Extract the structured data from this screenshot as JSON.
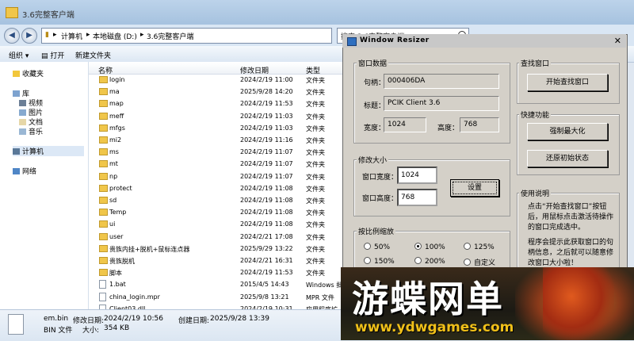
{
  "explorer": {
    "window_title": "3.6完整客户端",
    "address": {
      "segments": [
        "计算机",
        "本地磁盘 (D:)",
        "3.6完整客户端"
      ]
    },
    "search_placeholder": "搜索 3.6完整客户端",
    "toolbar": {
      "organize": "组织",
      "open": "打开",
      "new_folder": "新建文件夹"
    },
    "nav": {
      "favorites": "收藏夹",
      "library": "库",
      "videos": "视频",
      "pictures": "图片",
      "documents": "文档",
      "music": "音乐",
      "computer": "计算机",
      "network": "网络"
    },
    "columns": {
      "name": "名称",
      "date": "修改日期",
      "type": "类型"
    },
    "rows": [
      {
        "name": "login",
        "date": "2024/2/19 11:00",
        "type": "文件夹",
        "kind": "folder"
      },
      {
        "name": "ma",
        "date": "2025/9/28 14:20",
        "type": "文件夹",
        "kind": "folder"
      },
      {
        "name": "map",
        "date": "2024/2/19 11:53",
        "type": "文件夹",
        "kind": "folder"
      },
      {
        "name": "meff",
        "date": "2024/2/19 11:03",
        "type": "文件夹",
        "kind": "folder"
      },
      {
        "name": "mfgs",
        "date": "2024/2/19 11:03",
        "type": "文件夹",
        "kind": "folder"
      },
      {
        "name": "mi2",
        "date": "2024/2/19 11:16",
        "type": "文件夹",
        "kind": "folder"
      },
      {
        "name": "ms",
        "date": "2024/2/19 11:07",
        "type": "文件夹",
        "kind": "folder"
      },
      {
        "name": "mt",
        "date": "2024/2/19 11:07",
        "type": "文件夹",
        "kind": "folder"
      },
      {
        "name": "np",
        "date": "2024/2/19 11:07",
        "type": "文件夹",
        "kind": "folder"
      },
      {
        "name": "protect",
        "date": "2024/2/19 11:08",
        "type": "文件夹",
        "kind": "folder"
      },
      {
        "name": "sd",
        "date": "2024/2/19 11:08",
        "type": "文件夹",
        "kind": "folder"
      },
      {
        "name": "Temp",
        "date": "2024/2/19 11:08",
        "type": "文件夹",
        "kind": "folder"
      },
      {
        "name": "ui",
        "date": "2024/2/19 11:08",
        "type": "文件夹",
        "kind": "folder"
      },
      {
        "name": "user",
        "date": "2024/2/21 17:08",
        "type": "文件夹",
        "kind": "folder"
      },
      {
        "name": "贵族内挂+脱机+鼠标连点器",
        "date": "2025/9/29 13:22",
        "type": "文件夹",
        "kind": "folder"
      },
      {
        "name": "贵族脱机",
        "date": "2024/2/21 16:31",
        "type": "文件夹",
        "kind": "folder"
      },
      {
        "name": "脚本",
        "date": "2024/2/19 11:53",
        "type": "文件夹",
        "kind": "folder"
      },
      {
        "name": "1.bat",
        "date": "2015/4/5 14:43",
        "type": "Windows 批",
        "kind": "file"
      },
      {
        "name": "china_login.mpr",
        "date": "2025/9/8 13:21",
        "type": "MPR 文件",
        "kind": "file"
      },
      {
        "name": "Client03.dll",
        "date": "2024/2/19 10:31",
        "type": "应用程序扩",
        "kind": "file"
      }
    ],
    "details": {
      "filename": "em.bin",
      "modified_label": "修改日期:",
      "modified": "2024/2/19 10:56",
      "created_label": "创建日期:",
      "created": "2025/9/28 13:39",
      "filetype": "BIN 文件",
      "size_label": "大小:",
      "size": "354 KB"
    }
  },
  "resizer": {
    "title": "Window Resizer",
    "window_data": {
      "group_label": "窗口数据",
      "handle_label": "句柄：",
      "handle": "000406DA",
      "title_label": "标题：",
      "title_value": "PCIK Client 3.6",
      "width_label": "宽度：",
      "width": "1024",
      "height_label": "高度：",
      "height": "768"
    },
    "find": {
      "group_label": "查找窗口",
      "button": "开始查找窗口"
    },
    "quick": {
      "group_label": "快捷功能",
      "maximize": "强制最大化",
      "restore": "还原初始状态"
    },
    "modify": {
      "group_label": "修改大小",
      "width_label": "窗口宽度：",
      "width": "1024",
      "height_label": "窗口高度：",
      "height": "768",
      "set_button": "设置"
    },
    "scale": {
      "group_label": "按比例缩放",
      "options": [
        "50%",
        "100%",
        "125%",
        "150%",
        "200%",
        "自定义"
      ],
      "selected": "100%"
    },
    "help": {
      "group_label": "使用说明",
      "text1": "点击“开始查找窗口”按钮后，用鼠标点击激活待操作的窗口完成选中。",
      "text2": "程序会提示此获取窗口的句柄信息，之后就可以随意修改窗口大小啦！"
    }
  },
  "banner": {
    "headline": "游蝶网单",
    "url": "www.ydwgames.com"
  }
}
